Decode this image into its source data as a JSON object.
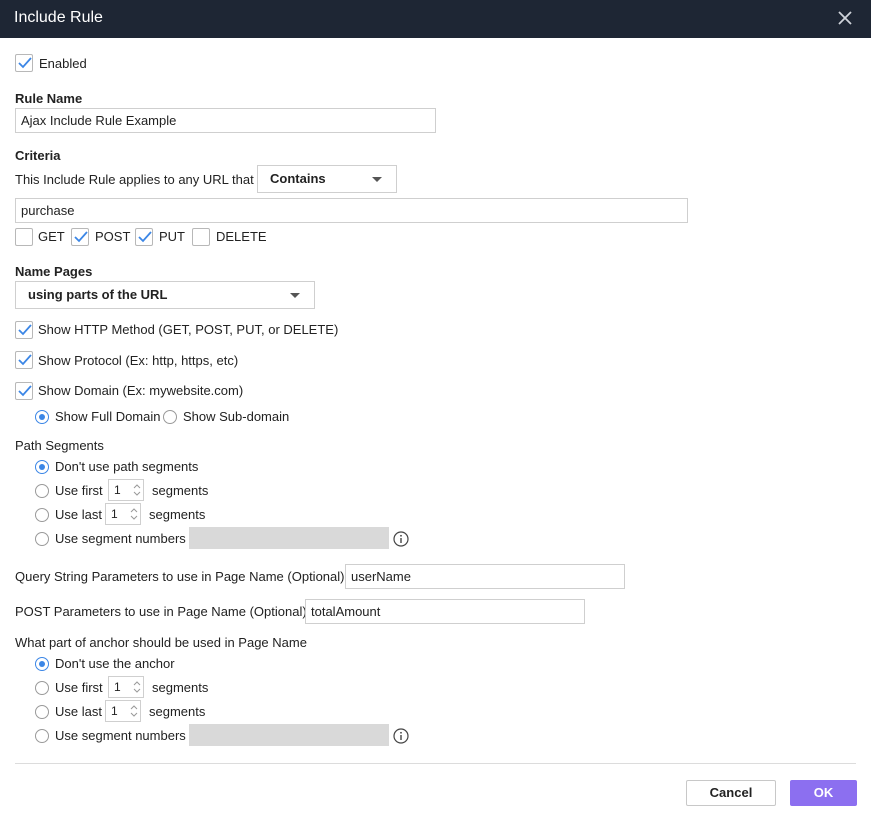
{
  "dialog": {
    "title": "Include Rule"
  },
  "enabled": {
    "label": "Enabled",
    "checked": true
  },
  "rule_name": {
    "heading": "Rule Name",
    "value": "Ajax Include Rule Example"
  },
  "criteria": {
    "heading": "Criteria",
    "applies_text": "This Include Rule applies to any URL that",
    "match_select": "Contains",
    "url_value": "purchase",
    "methods": [
      {
        "label": "GET",
        "checked": false
      },
      {
        "label": "POST",
        "checked": true
      },
      {
        "label": "PUT",
        "checked": true
      },
      {
        "label": "DELETE",
        "checked": false
      }
    ]
  },
  "name_pages": {
    "heading": "Name Pages",
    "select": "using parts of the URL",
    "show_http_method": "Show HTTP Method (GET, POST, PUT, or DELETE)",
    "show_protocol": "Show Protocol (Ex: http, https, etc)",
    "show_domain": "Show Domain (Ex: mywebsite.com)",
    "show_full_domain": "Show Full Domain",
    "show_sub_domain": "Show Sub-domain"
  },
  "path_segments": {
    "heading": "Path Segments",
    "dont_use": "Don't use path segments",
    "use_first": "Use first",
    "use_last": "Use last",
    "use_numbers": "Use segment numbers",
    "segments_word": "segments",
    "first_value": "1",
    "last_value": "1"
  },
  "query_params": {
    "label": "Query String Parameters to use in Page Name (Optional)",
    "value": "userName"
  },
  "post_params": {
    "label": "POST Parameters to use in Page Name (Optional)",
    "value": "totalAmount"
  },
  "anchor": {
    "heading": "What part of anchor should be used in Page Name",
    "dont_use": "Don't use the anchor",
    "use_first": "Use first",
    "use_last": "Use last",
    "use_numbers": "Use segment numbers",
    "segments_word": "segments",
    "first_value": "1",
    "last_value": "1"
  },
  "footer": {
    "cancel": "Cancel",
    "ok": "OK"
  },
  "colors": {
    "titlebar": "#1e2634",
    "accent": "#3b86e6",
    "ok_button": "#8c6ff0"
  },
  "icons": {
    "close": "close-icon",
    "check": "checkmark-icon",
    "info": "info-icon",
    "caret": "caret-down-icon"
  }
}
